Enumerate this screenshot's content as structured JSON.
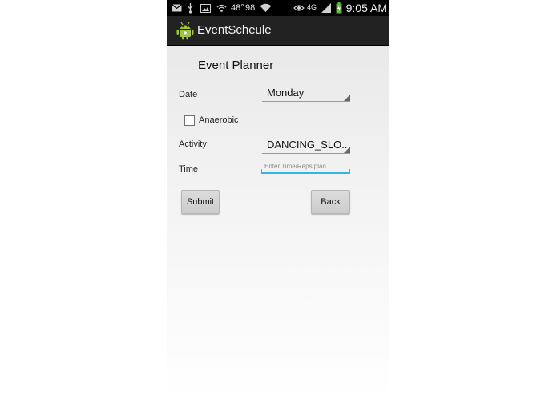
{
  "status_bar": {
    "temperature": "48°",
    "battery_percent": "98",
    "network": "4G",
    "time": "9:05 AM",
    "icons": [
      "mail-icon",
      "usb-icon",
      "gallery-icon",
      "hotspot-icon",
      "wifi-icon",
      "eye-icon",
      "signal-icon",
      "battery-charging-icon"
    ]
  },
  "action_bar": {
    "title": "EventScheule",
    "logo_icon": "android-icon"
  },
  "form": {
    "heading": "Event Planner",
    "date_label": "Date",
    "date_value": "Monday",
    "checkbox_label": "Anaerobic",
    "checkbox_checked": false,
    "activity_label": "Activity",
    "activity_value": "DANCING_SLO..",
    "time_label": "Time",
    "time_placeholder": "Enter Time/Reps plan",
    "time_value": "",
    "submit_label": "Submit",
    "back_label": "Back"
  },
  "colors": {
    "status_bar_bg": "#000000",
    "action_bar_bg": "#222222",
    "accent": "#33b5e5",
    "button_bg": "#d6d6d6"
  }
}
